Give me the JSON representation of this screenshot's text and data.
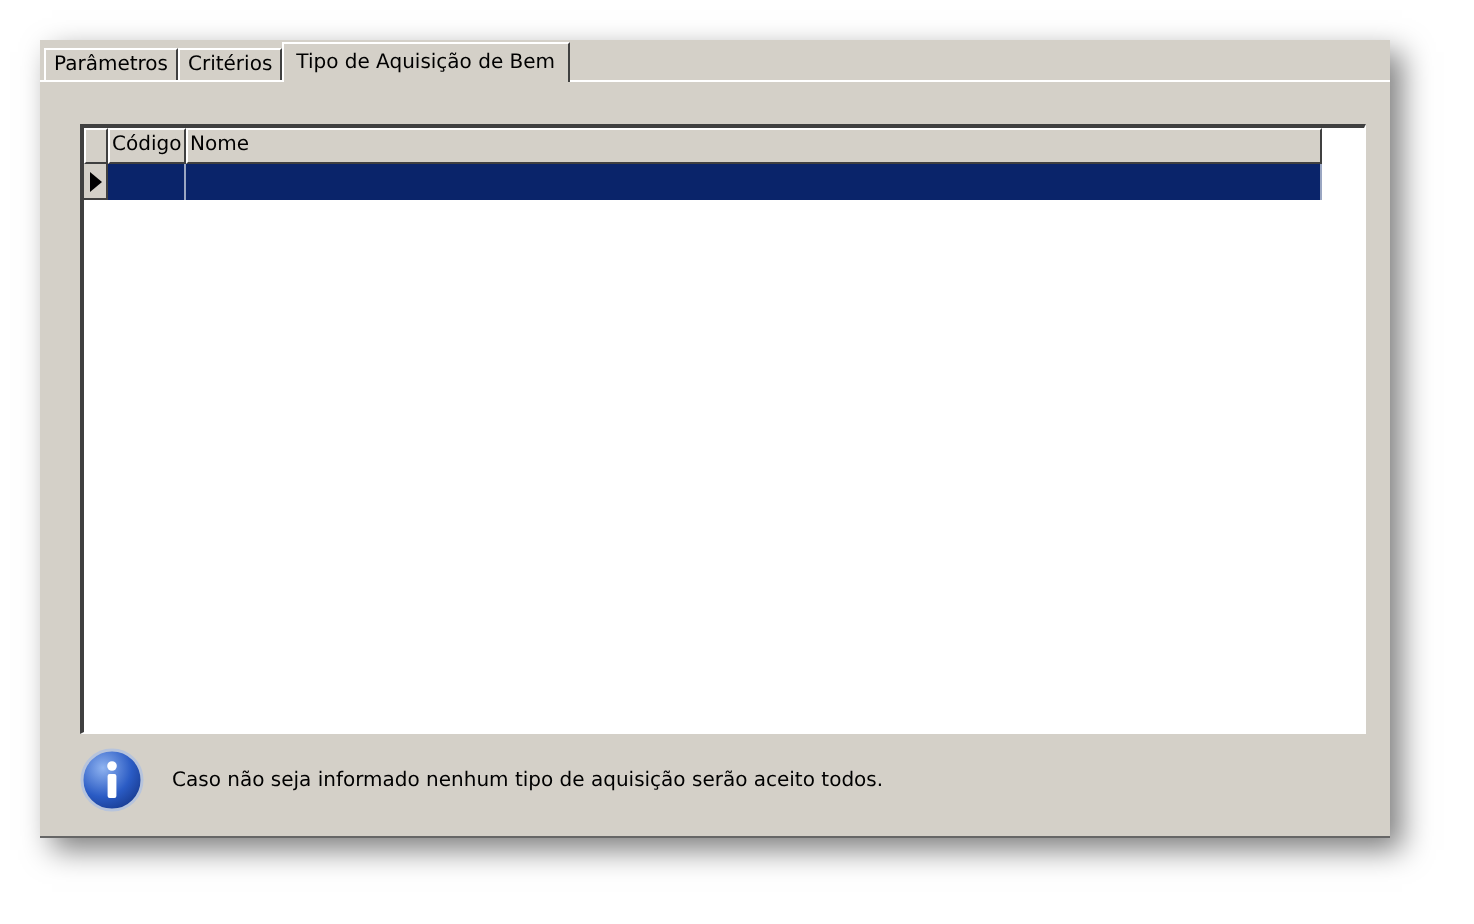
{
  "tabs": [
    {
      "label": "Parâmetros",
      "selected": false
    },
    {
      "label": "Critérios",
      "selected": false
    },
    {
      "label": "Tipo de Aquisição de Bem",
      "selected": true
    }
  ],
  "grid": {
    "columns": [
      "Código",
      "Nome"
    ],
    "rows": [
      {
        "selected": true
      }
    ]
  },
  "info_message": "Caso não seja informado nenhum tipo de aquisição serão aceito todos."
}
